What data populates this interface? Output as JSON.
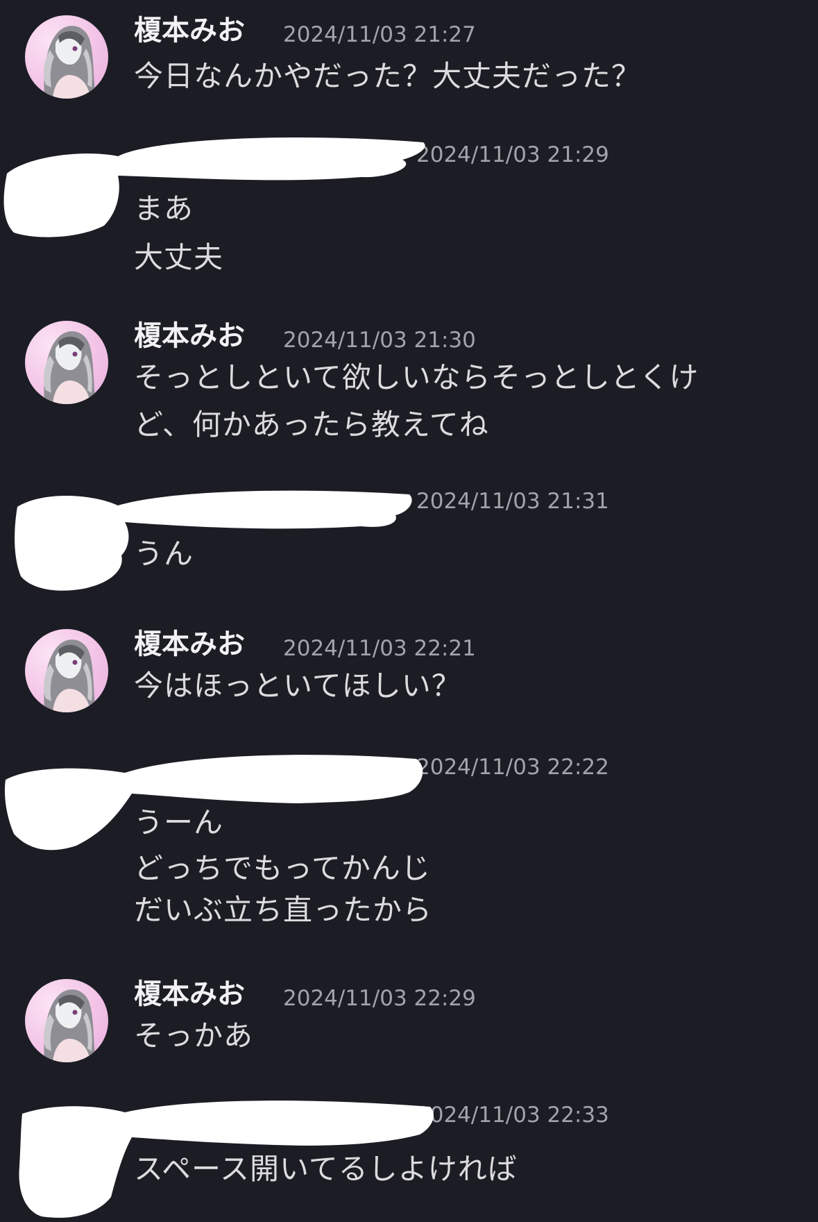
{
  "messages": [
    {
      "sender": "榎本みお",
      "timestamp": "2024/11/03 21:27",
      "lines": [
        "今日なんかやだった？大丈夫だった？"
      ],
      "redacted": false
    },
    {
      "sender": "",
      "timestamp": "2024/11/03 21:29",
      "lines": [
        "まあ",
        "大丈夫"
      ],
      "redacted": true
    },
    {
      "sender": "榎本みお",
      "timestamp": "2024/11/03 21:30",
      "lines": [
        "そっとしといて欲しいならそっとしとくけ",
        "ど、何かあったら教えてね"
      ],
      "redacted": false
    },
    {
      "sender": "",
      "timestamp": "2024/11/03 21:31",
      "lines": [
        "うん"
      ],
      "redacted": true
    },
    {
      "sender": "榎本みお",
      "timestamp": "2024/11/03 22:21",
      "lines": [
        "今はほっといてほしい？"
      ],
      "redacted": false
    },
    {
      "sender": "",
      "timestamp": "2024/11/03 22:22",
      "lines": [
        "うーん",
        "どっちでもってかんじ",
        "だいぶ立ち直ったから"
      ],
      "redacted": true
    },
    {
      "sender": "榎本みお",
      "timestamp": "2024/11/03 22:29",
      "lines": [
        "そっかあ"
      ],
      "redacted": false
    },
    {
      "sender": "",
      "timestamp": "2024/11/03 22:33",
      "lines": [
        "スペース開いてるしよければ"
      ],
      "redacted": true
    }
  ],
  "colors": {
    "background": "#1c1d24",
    "sender_name": "#f2f2f4",
    "timestamp": "#a3a4ab",
    "message_text": "#dcdcde",
    "redaction": "#ffffff"
  },
  "icons": {
    "avatar": "user-avatar-icon"
  }
}
